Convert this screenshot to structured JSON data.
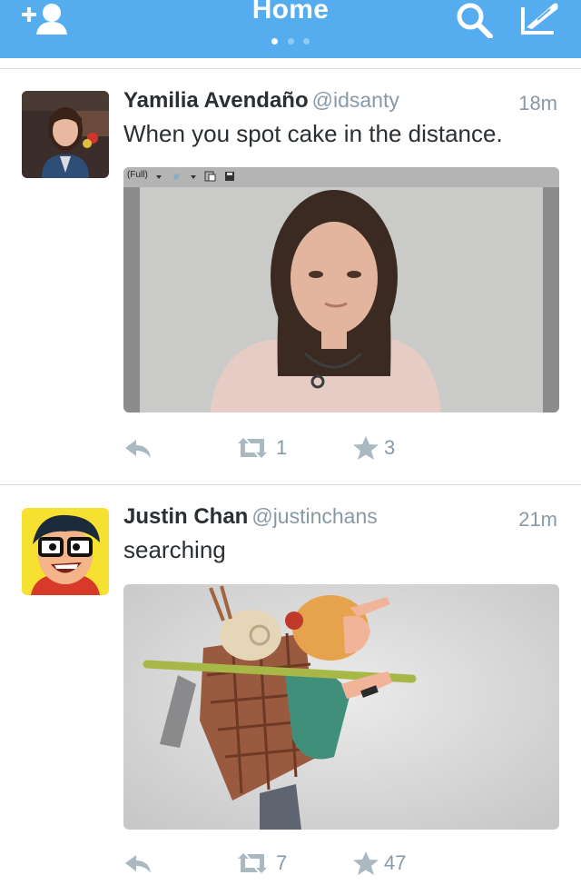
{
  "header": {
    "title": "Home",
    "page_dots": 3,
    "active_dot": 0,
    "icons": [
      "add-user-icon",
      "search-icon",
      "compose-icon"
    ],
    "color": "#55acee"
  },
  "tweets": [
    {
      "name": "Yamilia Avendaño",
      "handle": "@idsanty",
      "time": "18m",
      "text": "When you spot cake in the distance.",
      "media_caption": "(Full)",
      "retweets": "1",
      "favorites": "3"
    },
    {
      "name": "Justin Chan",
      "handle": "@justinchans",
      "time": "21m",
      "text": "searching",
      "retweets": "7",
      "favorites": "47"
    }
  ]
}
